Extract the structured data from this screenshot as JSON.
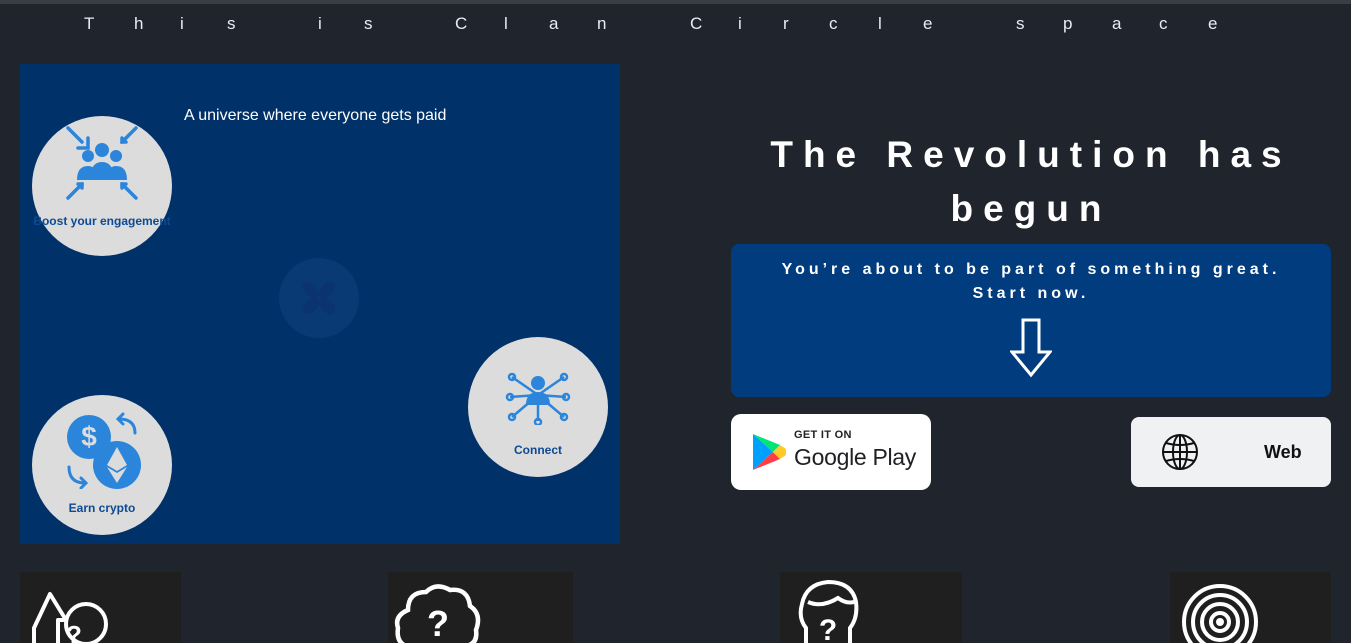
{
  "header": {
    "title_letters": [
      "T",
      "h",
      "i",
      "s",
      "i",
      "s",
      "C",
      "l",
      "a",
      "n",
      "C",
      "i",
      "r",
      "c",
      "l",
      "e",
      "s",
      "p",
      "a",
      "c",
      "e"
    ]
  },
  "panel": {
    "caption": "A universe where everyone gets paid",
    "bubbles": {
      "boost": "Boost your engagement",
      "earn": "Earn crypto",
      "connect": "Connect"
    },
    "icons": {
      "boost": "people-group-icon",
      "earn": "crypto-exchange-icon",
      "connect": "network-node-icon",
      "center": "clover-logo-icon"
    }
  },
  "hero": {
    "headline": "The Revolution has begun",
    "cta_line1": "You’re about to be part of something great.",
    "cta_line2": "Start now.",
    "cta_icon": "arrow-down-icon"
  },
  "download": {
    "google_play_small": "GET IT ON",
    "google_play_big": "Google Play",
    "web_label": "Web",
    "web_icon": "globe-icon"
  },
  "tiles": {
    "icons": [
      "question-arrows-icon",
      "question-cloud-icon",
      "question-head-icon",
      "signal-icon"
    ]
  },
  "colors": {
    "background": "#20242d",
    "panel": "#003168",
    "cta": "#003c7e",
    "accent": "#1e88e5",
    "bubble": "#dcdcdc"
  }
}
